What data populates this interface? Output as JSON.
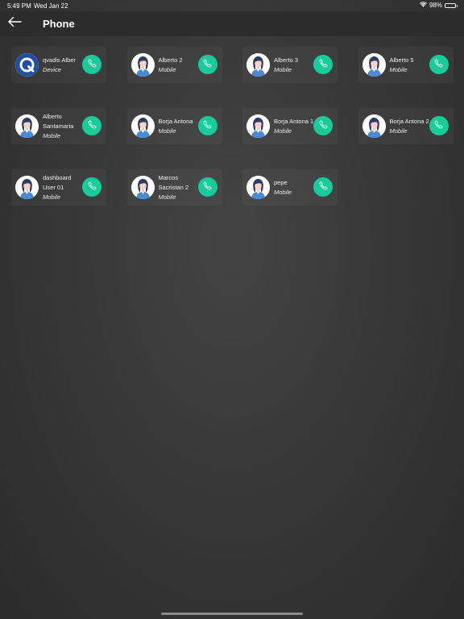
{
  "status": {
    "time": "5:49 PM",
    "date": "Wed Jan 22",
    "battery": "98%",
    "battery_level": 0.98
  },
  "header": {
    "title": "Phone",
    "back_icon": "arrow-left-icon"
  },
  "colors": {
    "call_button": "#18cc9a",
    "header_bg": "#2c2c2c"
  },
  "contacts": [
    {
      "name": "qvadis Alber",
      "type": "Device",
      "avatar": "qvadis-logo"
    },
    {
      "name": "Alberto 2",
      "type": "Mobile",
      "avatar": "user-avatar"
    },
    {
      "name": "Alberto 3",
      "type": "Mobile",
      "avatar": "user-avatar"
    },
    {
      "name": "Alberto 5",
      "type": "Mobile",
      "avatar": "user-avatar"
    },
    {
      "name": "Alberto Santamaria",
      "type": "Mobile",
      "avatar": "user-avatar"
    },
    {
      "name": "Borja Antona",
      "type": "Mobile",
      "avatar": "user-avatar"
    },
    {
      "name": "Borja Antona 1",
      "type": "Mobile",
      "avatar": "user-avatar"
    },
    {
      "name": "Borja Antona 2",
      "type": "Mobile",
      "avatar": "user-avatar"
    },
    {
      "name": "dashboard User 01",
      "type": "Mobile",
      "avatar": "user-avatar"
    },
    {
      "name": "Marcos Sacristan 2",
      "type": "Mobile",
      "avatar": "user-avatar"
    },
    {
      "name": "pepe",
      "type": "Mobile",
      "avatar": "user-avatar"
    }
  ]
}
